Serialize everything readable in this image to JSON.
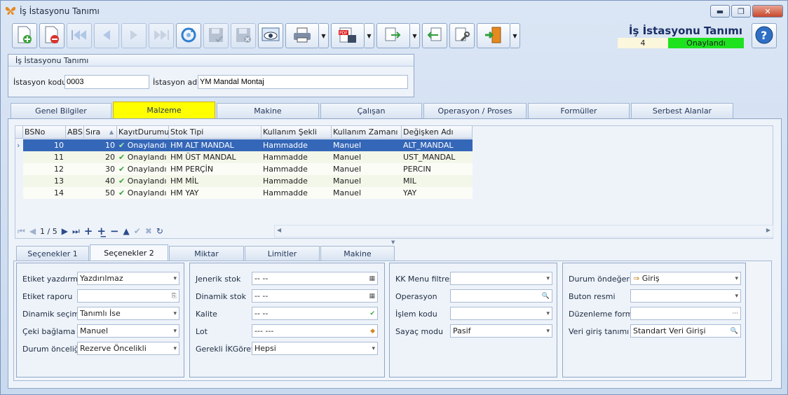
{
  "window": {
    "title": "İş İstasyonu Tanımı"
  },
  "header": {
    "title": "İş İstasyonu Tanımı",
    "record_no": "4",
    "status": "Onaylandı"
  },
  "toolbar": {
    "icons": [
      "new-doc-icon",
      "delete-doc-icon",
      "first-icon",
      "prev-icon",
      "next-icon",
      "last-icon",
      "refresh-icon",
      "save-icon",
      "save-cancel-icon",
      "preview-icon",
      "print-icon",
      "pdf-icon",
      "export-icon",
      "import-icon",
      "settings-icon",
      "exit-icon",
      "help-icon"
    ]
  },
  "group": {
    "title": "İş İstasyonu Tanımı",
    "code_label": "İstasyon kodu",
    "code_value": "0003",
    "name_label": "İstasyon adı",
    "name_value": "YM Mandal Montaj"
  },
  "tabs": [
    "Genel Bilgiler",
    "Malzeme",
    "Makine",
    "Çalışan",
    "Operasyon / Proses",
    "Formüller",
    "Serbest Alanlar"
  ],
  "grid": {
    "headers": [
      "BSNo",
      "ABSN",
      "Sıra",
      "KayıtDurumu",
      "Stok Tipi",
      "Kullanım Şekli",
      "Kullanım Zamanı",
      "Değişken Adı"
    ],
    "rows": [
      [
        "10",
        "",
        "10",
        "Onaylandı",
        "HM ALT MANDAL",
        "Hammadde",
        "Manuel",
        "ALT_MANDAL"
      ],
      [
        "11",
        "",
        "20",
        "Onaylandı",
        "HM ÜST MANDAL",
        "Hammadde",
        "Manuel",
        "UST_MANDAL"
      ],
      [
        "12",
        "",
        "30",
        "Onaylandı",
        "HM PERÇİN",
        "Hammadde",
        "Manuel",
        "PERCIN"
      ],
      [
        "13",
        "",
        "40",
        "Onaylandı",
        "HM MİL",
        "Hammadde",
        "Manuel",
        "MIL"
      ],
      [
        "14",
        "",
        "50",
        "Onaylandı",
        "HM YAY",
        "Hammadde",
        "Manuel",
        "YAY"
      ]
    ],
    "pager": "1 / 5"
  },
  "subtabs": [
    "Seçenekler 1",
    "Seçenekler 2",
    "Miktar",
    "Limitler",
    "Makine"
  ],
  "box1": {
    "f1": "Etiket yazdırma",
    "v1": "Yazdırılmaz",
    "f2": "Etiket raporu",
    "v2": "",
    "f3": "Dinamik seçim",
    "v3": "Tanımlı İse",
    "f4": "Çeki bağlama",
    "v4": "Manuel",
    "f5": "Durum önceliği",
    "v5": "Rezerve Öncelikli"
  },
  "box2": {
    "f1": "Jenerik stok",
    "v1": "-- --",
    "f2": "Dinamik stok",
    "v2": "-- --",
    "f3": "Kalite",
    "v3": "-- --",
    "f4": "Lot",
    "v4": "--- ---",
    "f5": "Gerekli İKGörev",
    "v5": "Hepsi"
  },
  "box3": {
    "f1": "KK Menu filtresi",
    "v1": "",
    "f2": "Operasyon",
    "v2": "",
    "f3": "İşlem kodu",
    "v3": "",
    "f4": "Sayaç modu",
    "v4": "Pasif"
  },
  "box4": {
    "f1": "Durum öndeğeri",
    "v1": "Giriş",
    "f2": "Buton resmi",
    "v2": "",
    "f3": "Düzenleme formu",
    "v3": "",
    "f4": "Veri giriş tanımı",
    "v4": "Standart Veri Girişi"
  },
  "colors": {
    "selected_row": "#3567b8",
    "active_tab": "#ffff00",
    "status_green": "#1fe21f"
  }
}
